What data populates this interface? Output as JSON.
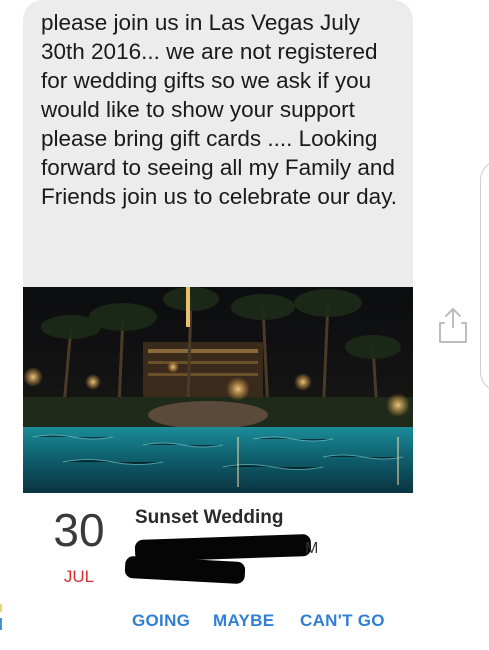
{
  "message": {
    "text": "please join us in Las Vegas July 30th 2016... we are not registered for wedding gifts so we ask if you would like to show your support please bring gift cards .... Looking forward to seeing all my Family and Friends join us to celebrate our day."
  },
  "event": {
    "day": "30",
    "month": "JUL",
    "title": "Sunset Wedding",
    "redacted_tail": "M",
    "actions": {
      "going": "GOING",
      "maybe": "MAYBE",
      "cant_go": "CAN'T GO"
    }
  },
  "colors": {
    "bubble": "#ececec",
    "accent": "#2f7fd3",
    "month": "#d43030"
  },
  "icons": {
    "share": "share-icon"
  }
}
